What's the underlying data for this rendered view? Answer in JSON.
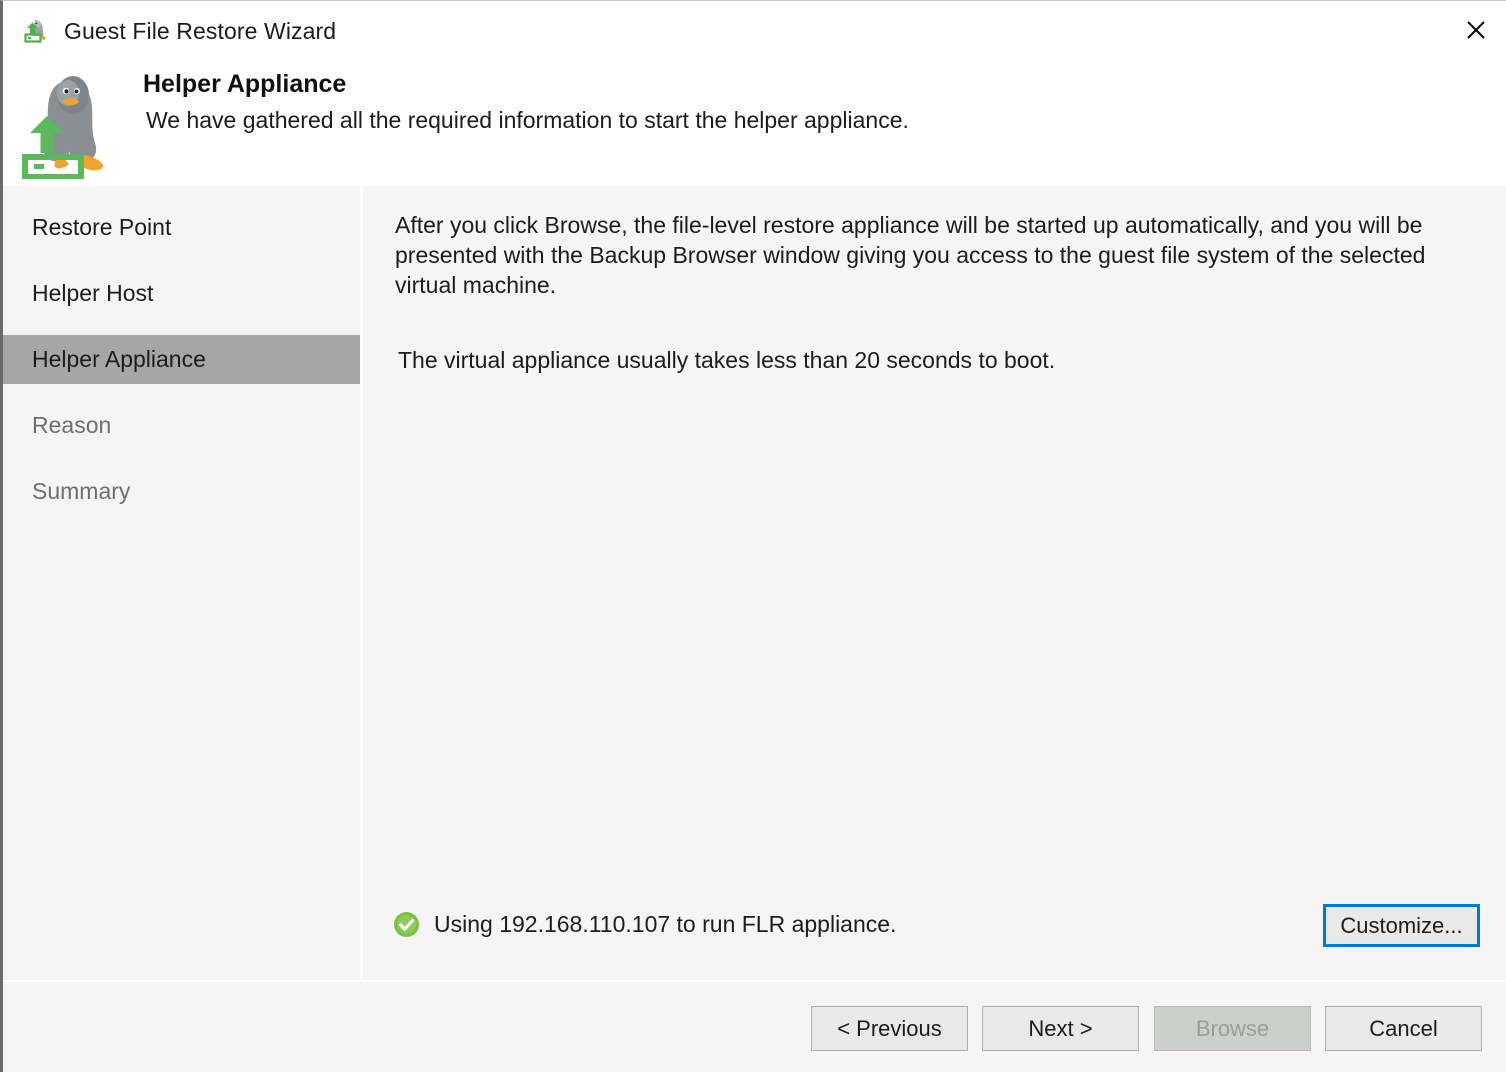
{
  "window": {
    "title": "Guest File Restore Wizard",
    "title_icon": "restore-wizard-icon",
    "close_icon": "close-icon"
  },
  "header": {
    "icon": "linux-penguin-upload-icon",
    "title": "Helper Appliance",
    "subtitle": "We have gathered all the required information to start the helper appliance."
  },
  "sidebar": {
    "items": [
      {
        "label": "Restore Point",
        "state": "done"
      },
      {
        "label": "Helper Host",
        "state": "done"
      },
      {
        "label": "Helper Appliance",
        "state": "active"
      },
      {
        "label": "Reason",
        "state": "pending"
      },
      {
        "label": "Summary",
        "state": "pending"
      }
    ]
  },
  "content": {
    "intro_paragraph": "After you click Browse, the file-level restore appliance will be started up automatically, and you will be presented with the Backup Browser window giving you access to the guest file system of the selected virtual machine.",
    "boot_note": "The virtual appliance usually takes less than 20 seconds to boot.",
    "status": {
      "icon": "success-check-icon",
      "text": "Using 192.168.110.107 to run FLR appliance.",
      "color": "#7ac143"
    },
    "customize_label": "Customize..."
  },
  "footer": {
    "buttons": [
      {
        "label": "< Previous",
        "disabled": false
      },
      {
        "label": "Next >",
        "disabled": false
      },
      {
        "label": "Browse",
        "disabled": true
      },
      {
        "label": "Cancel",
        "disabled": false
      }
    ]
  },
  "colors": {
    "focus_border": "#0078d7",
    "active_nav": "#a6a6a6",
    "surface": "#f5f5f5",
    "success": "#7ac143"
  }
}
